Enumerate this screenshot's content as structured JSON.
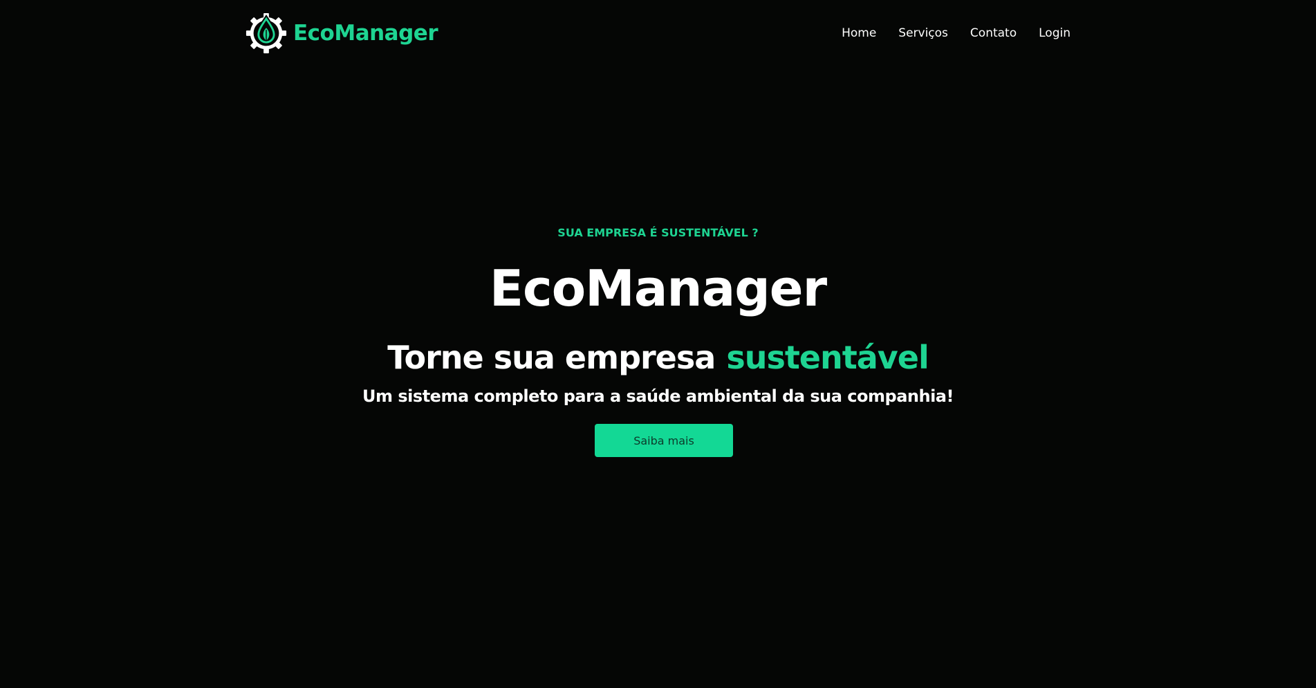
{
  "brand": {
    "name": "EcoManager",
    "logo_icon": "gear-drop-leaf-icon",
    "accent_color": "#1ed492"
  },
  "nav": {
    "items": [
      {
        "label": "Home"
      },
      {
        "label": "Serviços"
      },
      {
        "label": "Contato"
      },
      {
        "label": "Login"
      }
    ]
  },
  "hero": {
    "eyebrow": "SUA EMPRESA É SUSTENTÁVEL ?",
    "title": "EcoManager",
    "headline_prefix": "Torne sua empresa",
    "headline_accent": "sustentável",
    "subheadline": "Um sistema completo para a saúde ambiental da sua companhia!",
    "cta_label": "Saiba mais",
    "cta_color": "#13d895"
  },
  "colors": {
    "background": "#050605",
    "text": "#ffffff",
    "accent": "#1ed492"
  }
}
